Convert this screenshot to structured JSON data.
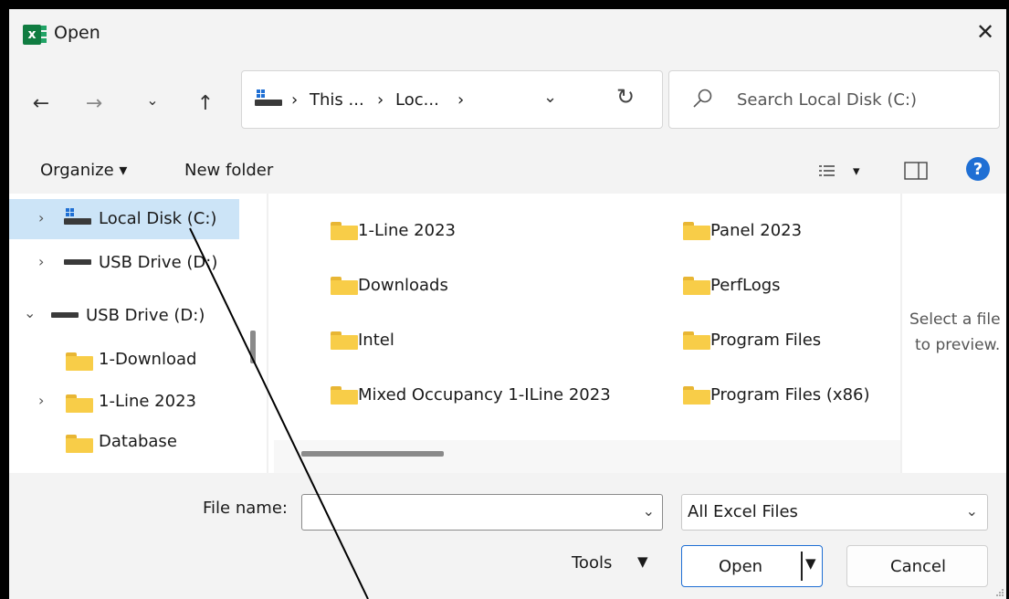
{
  "window": {
    "title": "Open",
    "app_icon": "excel-icon",
    "close_glyph": "✕"
  },
  "nav": {
    "back_glyph": "←",
    "forward_glyph": "→",
    "recent_glyph": "⌄",
    "up_glyph": "↑",
    "breadcrumbs": [
      "This ...",
      "Loc..."
    ],
    "breadcrumb_sep": "›",
    "dropdown_glyph": "⌄",
    "refresh_glyph": "↻"
  },
  "search": {
    "placeholder": "Search Local Disk (C:)"
  },
  "toolbar": {
    "organize": "Organize ▾",
    "new_folder": "New folder",
    "view_dd": "▾",
    "help": "?"
  },
  "sidebar": {
    "items": [
      {
        "label": "Local Disk (C:)",
        "icon": "windows-drive-icon",
        "chevron": "›",
        "selected": true
      },
      {
        "label": "USB Drive (D:)",
        "icon": "drive-icon",
        "chevron": "›"
      },
      {
        "label": "USB Drive (D:)",
        "icon": "drive-icon",
        "chevron": "⌄"
      },
      {
        "label": "1-Download",
        "icon": "folder-icon",
        "chevron": ""
      },
      {
        "label": "1-Line 2023",
        "icon": "folder-icon",
        "chevron": "›"
      },
      {
        "label": "Database",
        "icon": "folder-icon",
        "chevron": ""
      }
    ]
  },
  "files": {
    "col1": [
      "1-Line 2023",
      "Downloads",
      "Intel",
      "Mixed Occupancy 1-ILine 2023"
    ],
    "col2": [
      "Panel 2023",
      "PerfLogs",
      "Program Files",
      "Program Files (x86)"
    ]
  },
  "preview": {
    "line1": "Select a file",
    "line2": "to preview."
  },
  "footer": {
    "file_name_label": "File name:",
    "file_name_value": "",
    "file_type": "All Excel Files",
    "tools": "Tools",
    "tools_dd": "▼",
    "open": "Open",
    "open_dd": "▼",
    "cancel": "Cancel",
    "dd_glyph": "⌄"
  },
  "colors": {
    "accent": "#1f6fd4",
    "selected": "#cce4f7",
    "folder": "#f8cd48",
    "excel": "#107c41"
  }
}
